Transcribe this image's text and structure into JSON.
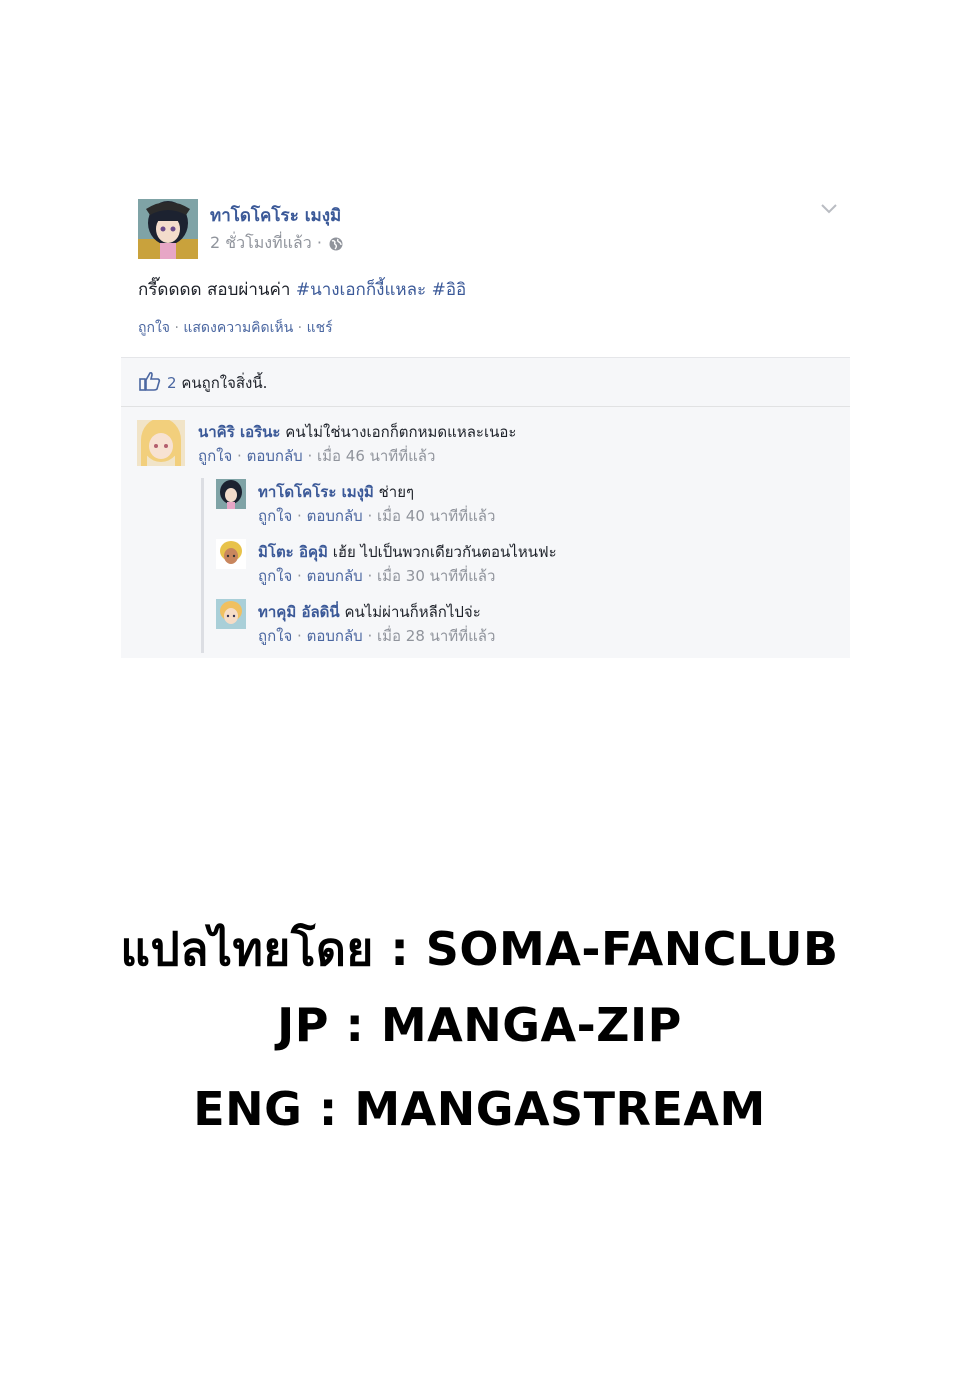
{
  "post": {
    "author": "ทาโดโคโระ เมงุมิ",
    "time": "2 ชั่วโมงที่แล้ว",
    "time_sep": "·",
    "text": "กรี๊ดดดด สอบผ่านค่า",
    "hashtags": [
      "#นางเอกก็งี้แหละ",
      "#อิอิ"
    ],
    "actions": [
      "ถูกใจ",
      "แสดงความคิดเห็น",
      "แชร์"
    ],
    "action_sep": "·",
    "likes_count": "2",
    "likes_text": "คนถูกใจสิ่งนี้."
  },
  "comments": [
    {
      "name": "นาคิริ เอรินะ",
      "text": "คนไม่ใช่นางเอกก็ตกหมดแหละเนอะ",
      "like": "ถูกใจ",
      "reply": "ตอบกลับ",
      "time": "เมื่อ 46 นาทีที่แล้ว"
    },
    {
      "name": "ทาโดโคโระ เมงุมิ",
      "text": "ช่ายๆ",
      "like": "ถูกใจ",
      "reply": "ตอบกลับ",
      "time": "เมื่อ 40 นาทีที่แล้ว"
    },
    {
      "name": "มิโตะ อิคุมิ",
      "text": "เฮ้ย ไปเป็นพวกเดียวกันตอนไหนฟะ",
      "like": "ถูกใจ",
      "reply": "ตอบกลับ",
      "time": "เมื่อ 30 นาทีที่แล้ว"
    },
    {
      "name": "ทาคุมิ อัลดินี่",
      "text": "คนไม่ผ่านก็หลีกไปจ่ะ",
      "like": "ถูกใจ",
      "reply": "ตอบกลับ",
      "time": "เมื่อ 28 นาทีที่แล้ว"
    }
  ],
  "credits": {
    "line1": "แปลไทยโดย : SOMA-FANCLUB",
    "line2": "JP : MANGA-ZIP",
    "line3": "ENG : MANGASTREAM"
  },
  "colors": {
    "link": "#3b5998",
    "muted": "#90949c",
    "panel": "#f6f7f9"
  },
  "icons": [
    "avatar",
    "globe-icon",
    "chevron-down-icon",
    "thumbs-up-icon"
  ]
}
